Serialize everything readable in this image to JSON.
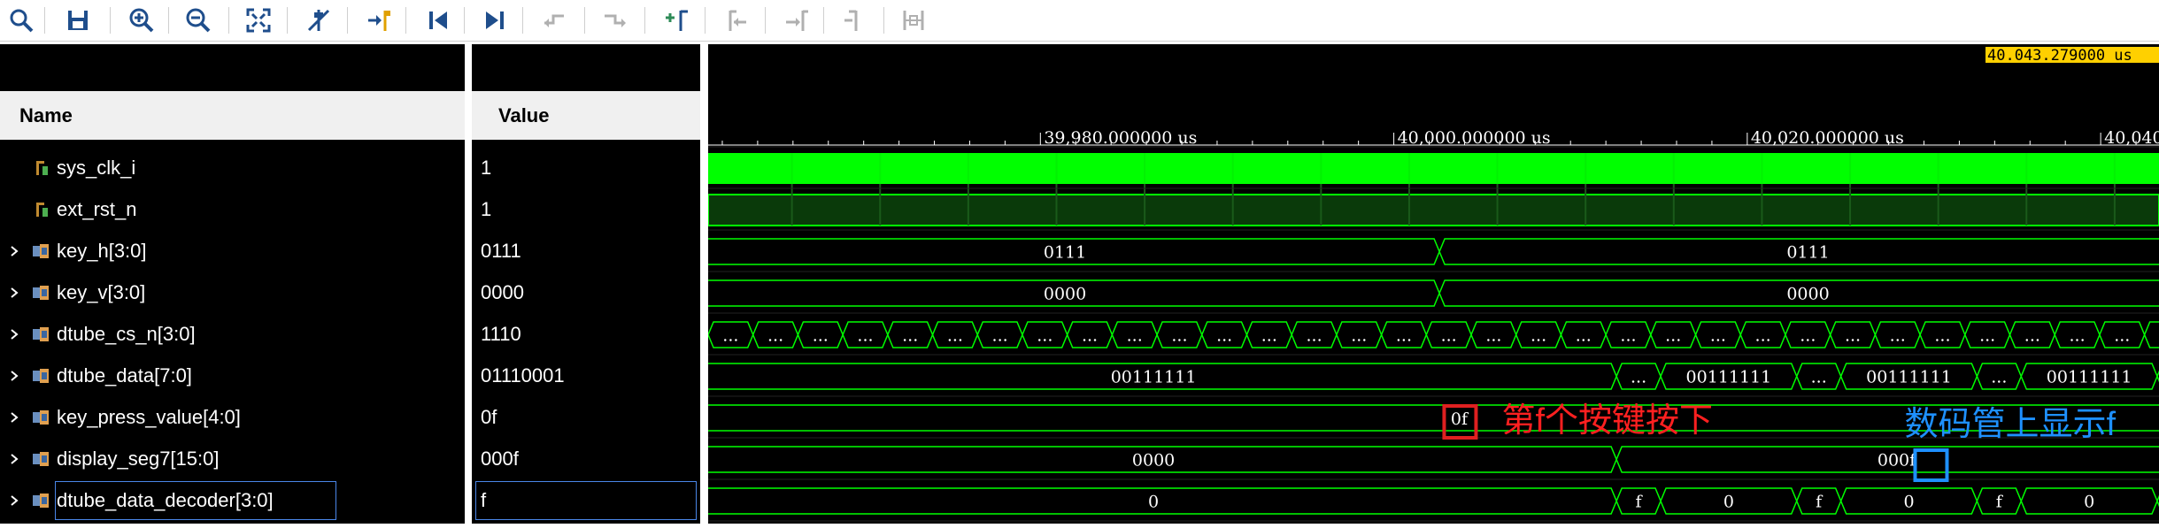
{
  "toolbar": {
    "buttons": [
      {
        "name": "search-icon",
        "color": "#1f4e8c"
      },
      {
        "name": "save-icon",
        "color": "#1f4e8c"
      },
      {
        "name": "zoom-in-icon",
        "color": "#1f4e8c"
      },
      {
        "name": "zoom-out-icon",
        "color": "#1f4e8c"
      },
      {
        "name": "zoom-fit-icon",
        "color": "#1f4e8c"
      },
      {
        "name": "cursor-off-icon",
        "color": "#1f4e8c"
      },
      {
        "name": "go-to-cursor-icon",
        "color": "#1f4e8c"
      },
      {
        "name": "go-to-start-icon",
        "color": "#1f4e8c"
      },
      {
        "name": "go-to-end-icon",
        "color": "#1f4e8c"
      },
      {
        "name": "previous-transition-icon",
        "color": "#b0b0b0"
      },
      {
        "name": "next-transition-icon",
        "color": "#b0b0b0"
      },
      {
        "name": "add-marker-icon",
        "color": "#2e8b57"
      },
      {
        "name": "previous-marker-icon",
        "color": "#b0b0b0"
      },
      {
        "name": "next-marker-icon",
        "color": "#b0b0b0"
      },
      {
        "name": "swap-cursors-icon",
        "color": "#b0b0b0"
      },
      {
        "name": "fix-cursor-icon",
        "color": "#b0b0b0"
      }
    ]
  },
  "columns": {
    "name_header": "Name",
    "value_header": "Value"
  },
  "signals": [
    {
      "name": "sys_clk_i",
      "value": "1",
      "kind": "bit",
      "expandable": false
    },
    {
      "name": "ext_rst_n",
      "value": "1",
      "kind": "bit",
      "expandable": false
    },
    {
      "name": "key_h[3:0]",
      "value": "0111",
      "kind": "bus",
      "expandable": true
    },
    {
      "name": "key_v[3:0]",
      "value": "0000",
      "kind": "bus",
      "expandable": true
    },
    {
      "name": "dtube_cs_n[3:0]",
      "value": "1110",
      "kind": "bus",
      "expandable": true
    },
    {
      "name": "dtube_data[7:0]",
      "value": "01110001",
      "kind": "bus",
      "expandable": true
    },
    {
      "name": "key_press_value[4:0]",
      "value": "0f",
      "kind": "bus",
      "expandable": true
    },
    {
      "name": "display_seg7[15:0]",
      "value": "000f",
      "kind": "bus",
      "expandable": true
    },
    {
      "name": "dtube_data_decoder[3:0]",
      "value": "f",
      "kind": "bus",
      "expandable": true
    }
  ],
  "waveform": {
    "cursor_time": "40.043.279000 us",
    "ruler_labels": [
      {
        "text": "39,980.000000 us",
        "t": 39980
      },
      {
        "text": "40,000.000000 us",
        "t": 40000
      },
      {
        "text": "40,020.000000 us",
        "t": 40020
      },
      {
        "text": "40,040",
        "t": 40040
      }
    ],
    "t_view_start": 39961.2,
    "t_view_end": 40043.3,
    "wave_color": "#00ff00",
    "bus_labels": {
      "key_h_before": "0111",
      "key_h_after": "0111",
      "key_v_before": "0000",
      "key_v_after": "0000",
      "cs_dots": "...",
      "data_long": "00111111",
      "data_short": "00111111",
      "data_dots": "...",
      "kpv_value": "0f",
      "seg7_before": "0000",
      "seg7_after": "000f",
      "dec_before": "0",
      "dec_f": "f",
      "dec_0": "0"
    },
    "annotations": [
      {
        "text": "第f个按键按下",
        "color": "#ff2020"
      },
      {
        "text": "数码管上显示f",
        "color": "#1e90ff"
      }
    ],
    "highlight_colors": {
      "red": "#e02020",
      "blue": "#1e90ff"
    }
  }
}
